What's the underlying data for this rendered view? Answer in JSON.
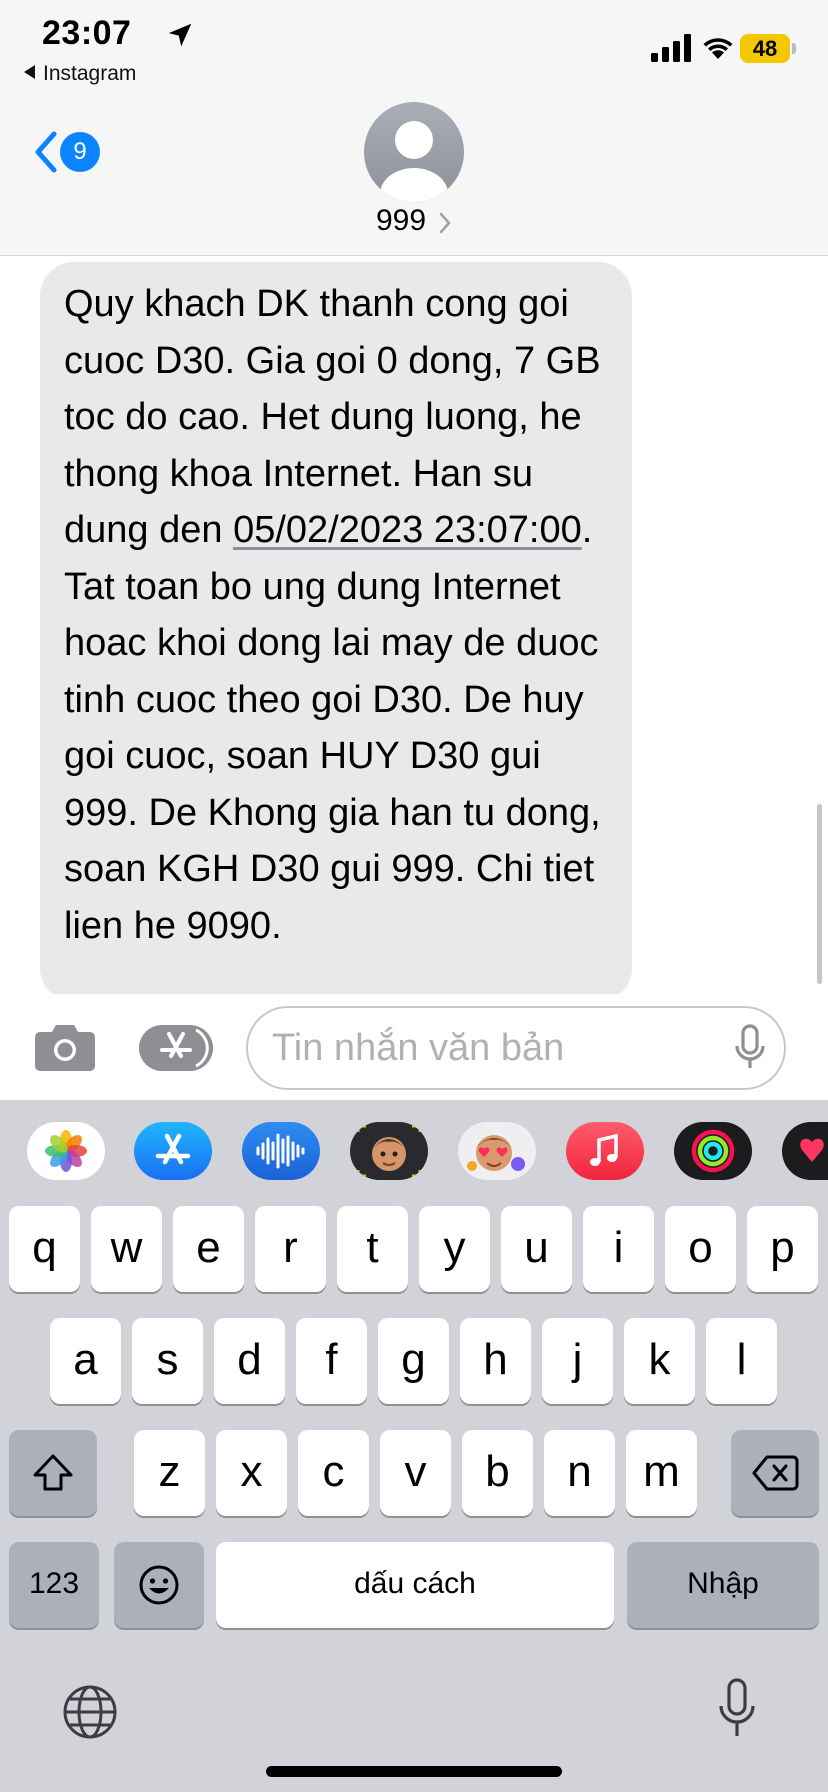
{
  "status_bar": {
    "time": "23:07",
    "back_app": "Instagram",
    "battery": "48",
    "icons": [
      "location-arrow-icon",
      "signal-bars-icon",
      "wifi-icon",
      "battery-icon"
    ]
  },
  "header": {
    "unread_count": "9",
    "contact_name": "999",
    "icons": [
      "back-chevron-icon",
      "contact-avatar-icon",
      "chevron-right-icon"
    ]
  },
  "message": {
    "part1": "Quy khach DK thanh cong goi cuoc D30. Gia goi 0 dong, 7 GB toc do cao. Het dung luong, he thong khoa Internet. Han su dung den ",
    "date_link": "05/02/2023 23:07:00",
    "part2": ". Tat toan bo ung dung Internet hoac khoi dong lai may de duoc tinh cuoc theo goi D30. De huy goi cuoc, soan HUY D30 gui 999. De Khong gia han tu dong, soan KGH D30 gui 999. Chi tiet lien he 9090."
  },
  "compose": {
    "placeholder": "Tin nhắn văn bản",
    "icons": [
      "camera-icon",
      "app-store-icon",
      "microphone-icon"
    ]
  },
  "app_strip": [
    "photos-icon",
    "app-store-icon",
    "audio-message-icon",
    "memoji-icon",
    "memoji-stickers-icon",
    "music-icon",
    "fitness-icon",
    "digital-touch-icon"
  ],
  "keyboard": {
    "row1": [
      "q",
      "w",
      "e",
      "r",
      "t",
      "y",
      "u",
      "i",
      "o",
      "p"
    ],
    "row2": [
      "a",
      "s",
      "d",
      "f",
      "g",
      "h",
      "j",
      "k",
      "l"
    ],
    "row3": [
      "z",
      "x",
      "c",
      "v",
      "b",
      "n",
      "m"
    ],
    "numbers_label": "123",
    "space_label": "dấu cách",
    "return_label": "Nhập",
    "icons": [
      "shift-icon",
      "delete-icon",
      "emoji-icon",
      "globe-icon",
      "microphone-icon"
    ]
  },
  "colors": {
    "accent": "#0a84ff",
    "bubble": "#e9e9eb",
    "keyboard_bg": "#d1d3d9",
    "battery_low_power": "#f5c700"
  }
}
